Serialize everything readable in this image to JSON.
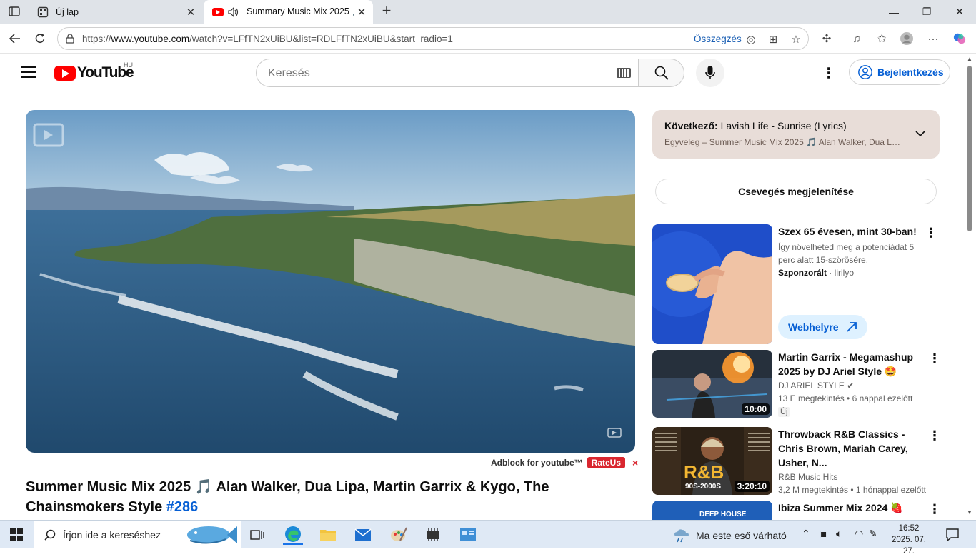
{
  "browser": {
    "tabs": [
      {
        "title": "Új lap",
        "icon": "new-tab-icon"
      },
      {
        "title": "Summary Music Mix 2025 🎵",
        "icon": "youtube-icon",
        "audio": true
      }
    ],
    "url_prefix": "https://",
    "url_domain": "www.youtube.com",
    "url_path": "/watch?v=LFfTN2xUiBU&list=RDLFfTN2xUiBU&start_radio=1",
    "summary_label": "Összegzés"
  },
  "youtube": {
    "logo_text": "YouTube",
    "country_code": "HU",
    "search_placeholder": "Keresés",
    "signin_label": "Bejelentkezés"
  },
  "video": {
    "title_main": "Summer Music Mix 2025 🎵 Alan Walker, Dua Lipa, Martin Garrix & Kygo, The Chainsmokers Style",
    "title_tag": "#286",
    "adblock_label": "Adblock for youtube™",
    "rateus_label": "RateUs",
    "close_label": "×"
  },
  "upnext": {
    "prefix": "Következő:",
    "title": "Lavish Life - Sunrise (Lyrics)",
    "subtitle": "Egyveleg – Summer Music Mix 2025 🎵 Alan Walker, Dua Li..."
  },
  "chat_button": "Csevegés megjelenítése",
  "recommendations": [
    {
      "title": "Szex 65 évesen, mint 30-ban!",
      "desc": "Így növelheted meg a potenciádat 5 perc alatt 15-szörösére.",
      "sponsored": "Szponzorált",
      "advertiser": "lirilyo",
      "cta": "Webhelyre"
    },
    {
      "title": "Martin Garrix - Megamashup 2025 by DJ Ariel Style 🤩",
      "channel": "DJ ARIEL STYLE",
      "views": "13 E megtekintés",
      "age": "6 nappal ezelőtt",
      "badge": "Új",
      "duration": "10:00"
    },
    {
      "title": "Throwback R&B Classics - Chris Brown, Mariah Carey, Usher, N...",
      "channel": "R&B Music Hits",
      "views": "3,2 M megtekintés",
      "age": "1 hónappal ezelőtt",
      "duration": "3:20:10",
      "thumb_text": "R&B",
      "thumb_sub": "90S-2000S"
    },
    {
      "title": "Ibiza Summer Mix 2024 🍓",
      "thumb_text": "DEEP HOUSE"
    }
  ],
  "taskbar": {
    "search_placeholder": "Írjon ide a kereséshez",
    "weather": "Ma este eső várható",
    "time": "16:52",
    "date": "2025. 07. 27."
  },
  "colors": {
    "youtube_red": "#ff0000",
    "link_blue": "#065fd4",
    "upnext_bg": "#e8ddd8"
  }
}
